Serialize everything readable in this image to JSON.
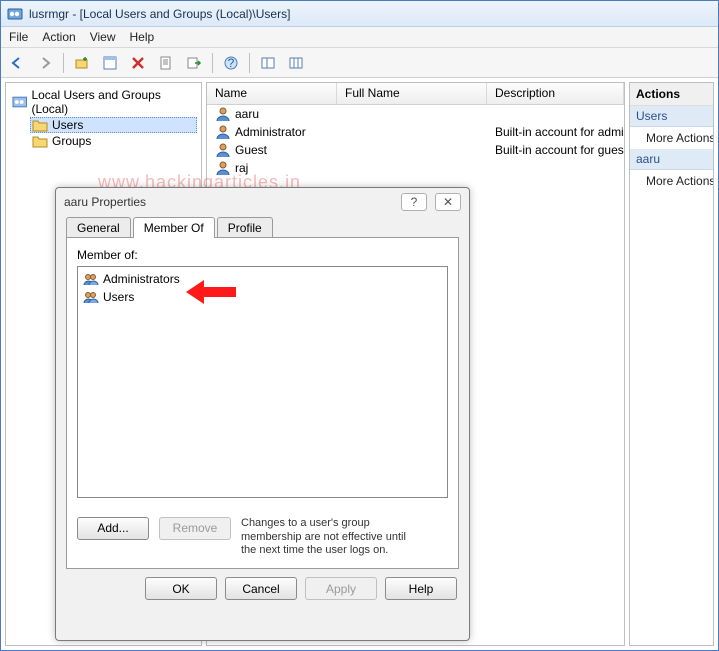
{
  "window": {
    "title": "lusrmgr - [Local Users and Groups (Local)\\Users]"
  },
  "menu": {
    "file": "File",
    "action": "Action",
    "view": "View",
    "help": "Help"
  },
  "tree": {
    "root": "Local Users and Groups (Local)",
    "users": "Users",
    "groups": "Groups"
  },
  "columns": {
    "name": "Name",
    "full": "Full Name",
    "desc": "Description"
  },
  "users": [
    {
      "name": "aaru",
      "full": "",
      "desc": ""
    },
    {
      "name": "Administrator",
      "full": "",
      "desc": "Built-in account for administering the computer/domain"
    },
    {
      "name": "Guest",
      "full": "",
      "desc": "Built-in account for guest access to the computer/domain"
    },
    {
      "name": "raj",
      "full": "",
      "desc": ""
    }
  ],
  "actions": {
    "header": "Actions",
    "section1": "Users",
    "more1": "More Actions",
    "section2": "aaru",
    "more2": "More Actions"
  },
  "dialog": {
    "title": "aaru Properties",
    "tabs": {
      "general": "General",
      "member": "Member Of",
      "profile": "Profile"
    },
    "memberLabel": "Member of:",
    "groups": [
      "Administrators",
      "Users"
    ],
    "add": "Add...",
    "remove": "Remove",
    "note": "Changes to a user's group membership are not effective until the next time the user logs on.",
    "ok": "OK",
    "cancel": "Cancel",
    "apply": "Apply",
    "help": "Help"
  },
  "watermark": "www.hackingarticles.in"
}
